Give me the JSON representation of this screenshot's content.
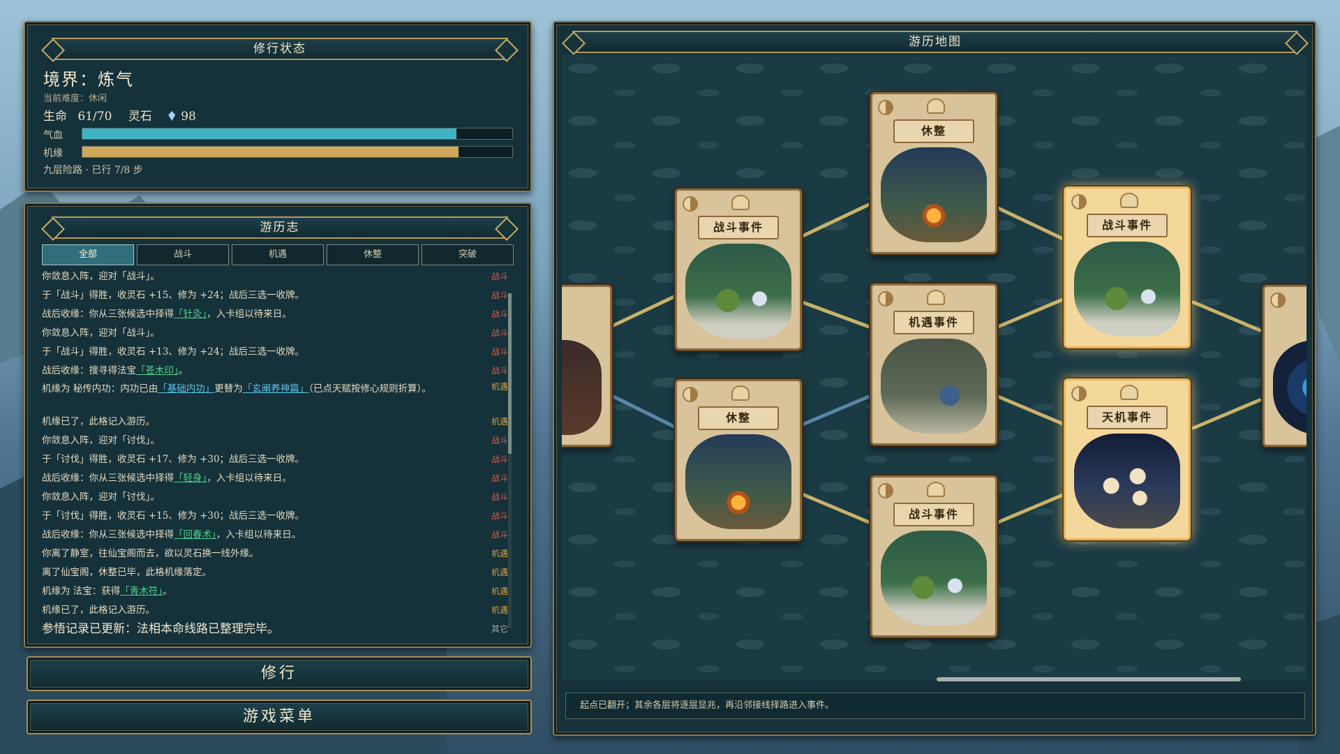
{
  "status": {
    "banner": "修行状态",
    "realm": "境界：炼气",
    "difficulty": "当前难度：休闲",
    "hp_label": "生命",
    "hp_value": "61/70",
    "stone_label": "灵石",
    "stone_value": "98",
    "qixue_label": "气血",
    "qixue_level": 0.87,
    "jiyuan_label": "机缘",
    "jiyuan_level": 0.875,
    "route": "九层险路 · 已行 7/8 步",
    "colors": {
      "qixue": "#3fb3c4",
      "jiyuan": "#d0a85a"
    }
  },
  "journal": {
    "banner": "游历志",
    "tabs": [
      "全部",
      "战斗",
      "机遇",
      "休整",
      "突破"
    ],
    "active_tab": "全部",
    "entries": [
      {
        "pre": "你敛息入阵，迎对「战斗」。",
        "kw": "",
        "post": "",
        "tag": "战斗",
        "type": "fight"
      },
      {
        "pre": "于「战斗」得胜，收灵石 +15、修为 +24；战后三选一收牌。",
        "kw": "",
        "post": "",
        "tag": "战斗",
        "type": "fight"
      },
      {
        "pre": "战后收缘：你从三张候选中择得",
        "kw": "「针灸」",
        "post": "，入卡组以待来日。",
        "tag": "战斗",
        "type": "fight",
        "kwc": "green"
      },
      {
        "pre": "你敛息入阵，迎对「战斗」。",
        "kw": "",
        "post": "",
        "tag": "战斗",
        "type": "fight"
      },
      {
        "pre": "于「战斗」得胜，收灵石 +13、修为 +24；战后三选一收牌。",
        "kw": "",
        "post": "",
        "tag": "战斗",
        "type": "fight"
      },
      {
        "pre": "战后收缘：搜寻得法宝",
        "kw": "「苍木印」",
        "post": "。",
        "tag": "战斗",
        "type": "fight",
        "kwc": "green"
      },
      {
        "pre": "机缘为 秘传内功：内功已由",
        "kw": "「基础内功」",
        "mid": "更替为",
        "kw2": "「玄阐养神篇」",
        "post": "（已点天赋按修心规则折算）。",
        "tag": "机遇",
        "type": "chance",
        "kwc": "blue",
        "tall": true
      },
      {
        "pre": "机缘已了，此格记入游历。",
        "kw": "",
        "post": "",
        "tag": "机遇",
        "type": "chance"
      },
      {
        "pre": "你敛息入阵，迎对「讨伐」。",
        "kw": "",
        "post": "",
        "tag": "战斗",
        "type": "fight"
      },
      {
        "pre": "于「讨伐」得胜，收灵石 +17、修为 +30；战后三选一收牌。",
        "kw": "",
        "post": "",
        "tag": "战斗",
        "type": "fight"
      },
      {
        "pre": "战后收缘：你从三张候选中择得",
        "kw": "「轻身」",
        "post": "，入卡组以待来日。",
        "tag": "战斗",
        "type": "fight",
        "kwc": "green"
      },
      {
        "pre": "你敛息入阵，迎对「讨伐」。",
        "kw": "",
        "post": "",
        "tag": "战斗",
        "type": "fight"
      },
      {
        "pre": "于「讨伐」得胜，收灵石 +15、修为 +30；战后三选一收牌。",
        "kw": "",
        "post": "",
        "tag": "战斗",
        "type": "fight"
      },
      {
        "pre": "战后收缘：你从三张候选中择得",
        "kw": "「回春术」",
        "post": "，入卡组以待来日。",
        "tag": "战斗",
        "type": "fight",
        "kwc": "green"
      },
      {
        "pre": "你离了静室，往仙宝阁而去，欲以灵石换一线外缘。",
        "kw": "",
        "post": "",
        "tag": "机遇",
        "type": "chance"
      },
      {
        "pre": "离了仙宝阁，休整已毕，此格机缘落定。",
        "kw": "",
        "post": "",
        "tag": "机遇",
        "type": "chance"
      },
      {
        "pre": "机缘为 法宝：获得",
        "kw": "「青木符」",
        "post": "。",
        "tag": "机遇",
        "type": "chance",
        "kwc": "green"
      },
      {
        "pre": "机缘已了，此格记入游历。",
        "kw": "",
        "post": "",
        "tag": "机遇",
        "type": "chance"
      },
      {
        "pre": "参悟记录已更新：法相本命线路已整理完毕。",
        "kw": "",
        "post": "",
        "tag": "其它",
        "type": "other",
        "big": true
      }
    ]
  },
  "buttons": {
    "cultivate": "修行",
    "menu": "游戏菜单"
  },
  "map": {
    "banner": "游历地图",
    "hint": "起点已翻开；其余各层将逐层显兆，再沿邻接线择路进入事件。",
    "cards": [
      {
        "id": "c-left-edge",
        "title": "",
        "scene": "dark",
        "lit": false,
        "partial": "left"
      },
      {
        "id": "c-fight-1",
        "title": "战斗事件",
        "scene": "fight",
        "lit": false
      },
      {
        "id": "c-rest-1",
        "title": "休整",
        "scene": "camp",
        "lit": false
      },
      {
        "id": "c-rest-top",
        "title": "休整",
        "scene": "camp",
        "lit": false
      },
      {
        "id": "c-chance",
        "title": "机遇事件",
        "scene": "chance",
        "lit": false
      },
      {
        "id": "c-fight-2",
        "title": "战斗事件",
        "scene": "fight",
        "lit": false
      },
      {
        "id": "c-fight-3",
        "title": "战斗事件",
        "scene": "fight",
        "lit": true
      },
      {
        "id": "c-tianji",
        "title": "天机事件",
        "scene": "dice",
        "lit": true
      },
      {
        "id": "c-right-edge",
        "title": "",
        "scene": "portal",
        "lit": false,
        "partial": "right"
      }
    ]
  }
}
